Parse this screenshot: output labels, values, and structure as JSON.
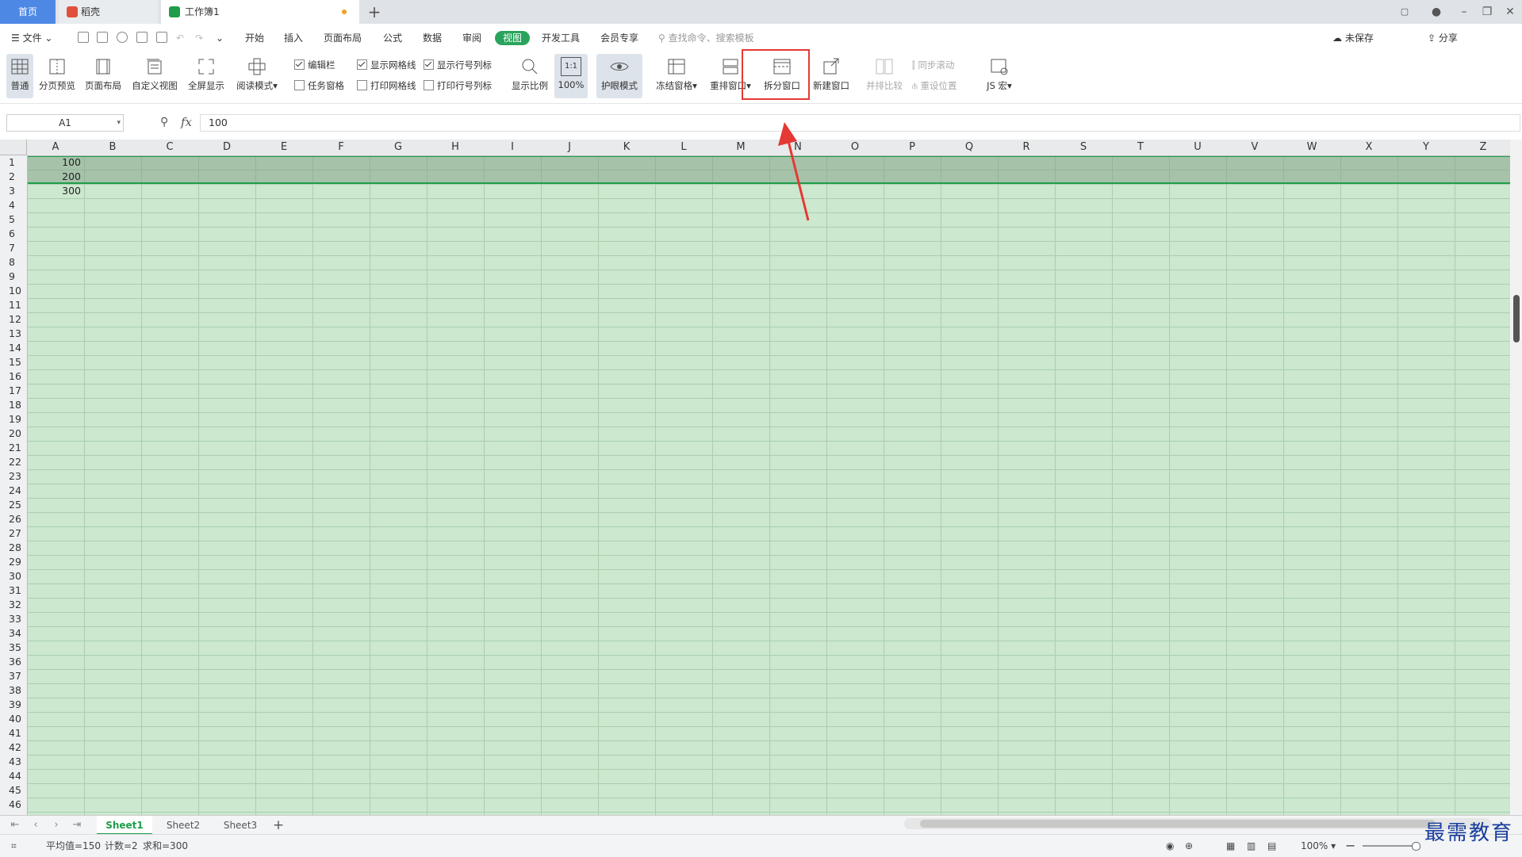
{
  "tabs": {
    "home": "首页",
    "wps": "稻壳",
    "workbook": "工作簿1",
    "new_tab": "+"
  },
  "menu": {
    "file": "文件",
    "items": [
      "开始",
      "插入",
      "页面布局",
      "公式",
      "数据",
      "审阅",
      "视图",
      "开发工具",
      "会员专享"
    ],
    "active": "视图",
    "search_placeholder": "查找命令、搜索模板",
    "cloud_status": "未保存",
    "share": "分享"
  },
  "ribbon": {
    "normal": "普通",
    "page_break_preview": "分页预览",
    "page_layout": "页面布局",
    "custom_view": "自定义视图",
    "full_screen": "全屏显示",
    "reading_mode": "阅读模式",
    "chk_edit_bar": "编辑栏",
    "chk_task_pane": "任务窗格",
    "chk_show_gridlines": "显示网格线",
    "chk_print_gridlines": "打印网格线",
    "chk_show_headings": "显示行号列标",
    "chk_print_headings": "打印行号列标",
    "zoom": "显示比例",
    "zoom_100": "100%",
    "zoom_100_icon": "1:1",
    "eye_mode": "护眼模式",
    "freeze": "冻结窗格",
    "arrange": "重排窗口",
    "split": "拆分窗口",
    "new_window": "新建窗口",
    "compare": "并排比较",
    "sync_scroll": "同步滚动",
    "reset_pos": "重设位置",
    "macro": "JS 宏"
  },
  "formula_bar": {
    "name_box": "A1",
    "fx": "fx",
    "value": "100"
  },
  "columns": [
    "A",
    "B",
    "C",
    "D",
    "E",
    "F",
    "G",
    "H",
    "I",
    "J",
    "K",
    "L",
    "M",
    "N",
    "O",
    "P",
    "Q",
    "R",
    "S",
    "T",
    "U",
    "V",
    "W",
    "X",
    "Y",
    "Z"
  ],
  "cells": {
    "A1": "100",
    "A2": "200",
    "A3": "300"
  },
  "sheets": [
    "Sheet1",
    "Sheet2",
    "Sheet3"
  ],
  "status": {
    "average": "平均值=150",
    "count": "计数=2",
    "sum": "求和=300",
    "zoom": "100%"
  },
  "watermark": "最需教育",
  "colors": {
    "accent": "#2aa45c",
    "grid_bg": "#cce8cf",
    "highlight": "#e53935",
    "home_tab": "#4e88e5"
  }
}
